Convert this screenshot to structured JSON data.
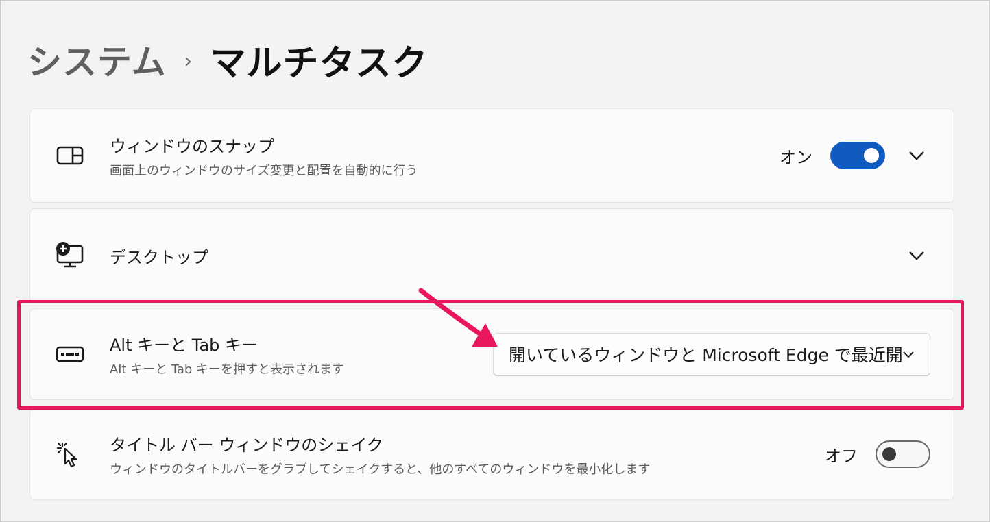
{
  "breadcrumb": {
    "parent": "システム",
    "separator": "›",
    "current": "マルチタスク"
  },
  "settings": [
    {
      "title": "ウィンドウのスナップ",
      "description": "画面上のウィンドウのサイズ変更と配置を自動的に行う",
      "icon": "snap-window-icon",
      "toggle_label": "オン",
      "toggle_state": "on"
    },
    {
      "title": "デスクトップ",
      "icon": "desktop-add-icon"
    },
    {
      "title": "Alt キーと Tab キー",
      "description": "Alt キーと Tab キーを押すと表示されます",
      "icon": "keyboard-icon",
      "dropdown_value": "開いているウィンドウと Microsoft Edge で最近開"
    },
    {
      "title": "タイトル バー ウィンドウのシェイク",
      "description": "ウィンドウのタイトルバーをグラブしてシェイクすると、他のすべてのウィンドウを最小化します",
      "icon": "cursor-shake-icon",
      "toggle_label": "オフ",
      "toggle_state": "off"
    }
  ],
  "colors": {
    "accent": "#0f5bbf",
    "highlight": "#e8175d"
  }
}
